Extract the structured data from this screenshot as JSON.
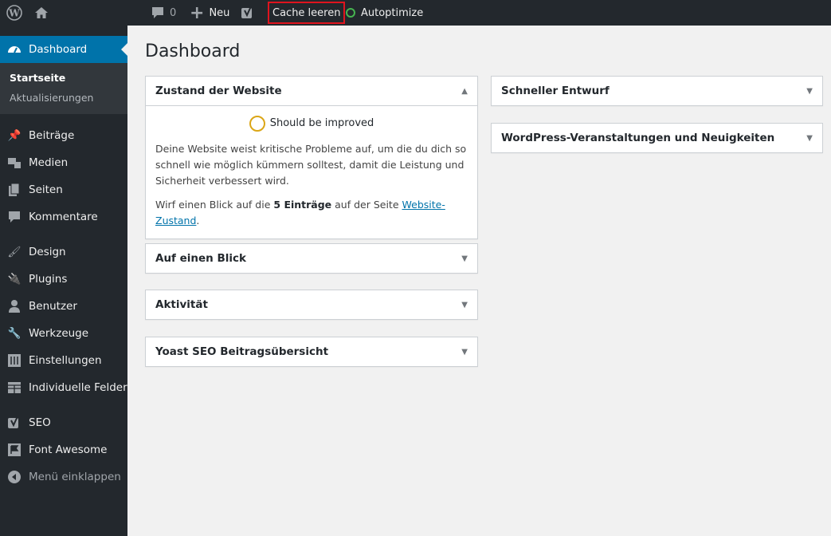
{
  "adminbar": {
    "comments_count": "0",
    "new_label": "Neu",
    "cache_label": "Cache leeren",
    "autoptimize_label": "Autoptimize",
    "autoptimize_status_color": "#46b450"
  },
  "sidebar": {
    "dashboard_label": "Dashboard",
    "submenu": [
      "Startseite",
      "Aktualisierungen"
    ],
    "items": [
      {
        "label": "Beiträge",
        "icon": "pin-icon"
      },
      {
        "label": "Medien",
        "icon": "media-icon"
      },
      {
        "label": "Seiten",
        "icon": "pages-icon"
      },
      {
        "label": "Kommentare",
        "icon": "comments-icon"
      },
      {
        "label": "Design",
        "icon": "brush-icon"
      },
      {
        "label": "Plugins",
        "icon": "plugin-icon"
      },
      {
        "label": "Benutzer",
        "icon": "user-icon"
      },
      {
        "label": "Werkzeuge",
        "icon": "wrench-icon"
      },
      {
        "label": "Einstellungen",
        "icon": "settings-icon"
      },
      {
        "label": "Individuelle Felder",
        "icon": "fields-icon"
      },
      {
        "label": "SEO",
        "icon": "yoast-icon"
      },
      {
        "label": "Font Awesome",
        "icon": "flag-icon"
      }
    ],
    "collapse_label": "Menü einklappen"
  },
  "main": {
    "title": "Dashboard",
    "site_health": {
      "title": "Zustand der Website",
      "status": "Should be improved",
      "description": "Deine Website weist kritische Probleme auf, um die du dich so schnell wie möglich kümmern solltest, damit die Leistung und Sicherheit verbessert wird.",
      "cta_pre": "Wirf einen Blick auf die ",
      "cta_bold": "5 Einträge",
      "cta_mid": " auf der Seite ",
      "cta_link": "Website-Zustand",
      "cta_post": "."
    },
    "left_boxes": [
      "Auf einen Blick",
      "Aktivität",
      "Yoast SEO Beitragsübersicht"
    ],
    "right_boxes": [
      "Schneller Entwurf",
      "WordPress-Veranstaltungen und Neuigkeiten"
    ]
  }
}
